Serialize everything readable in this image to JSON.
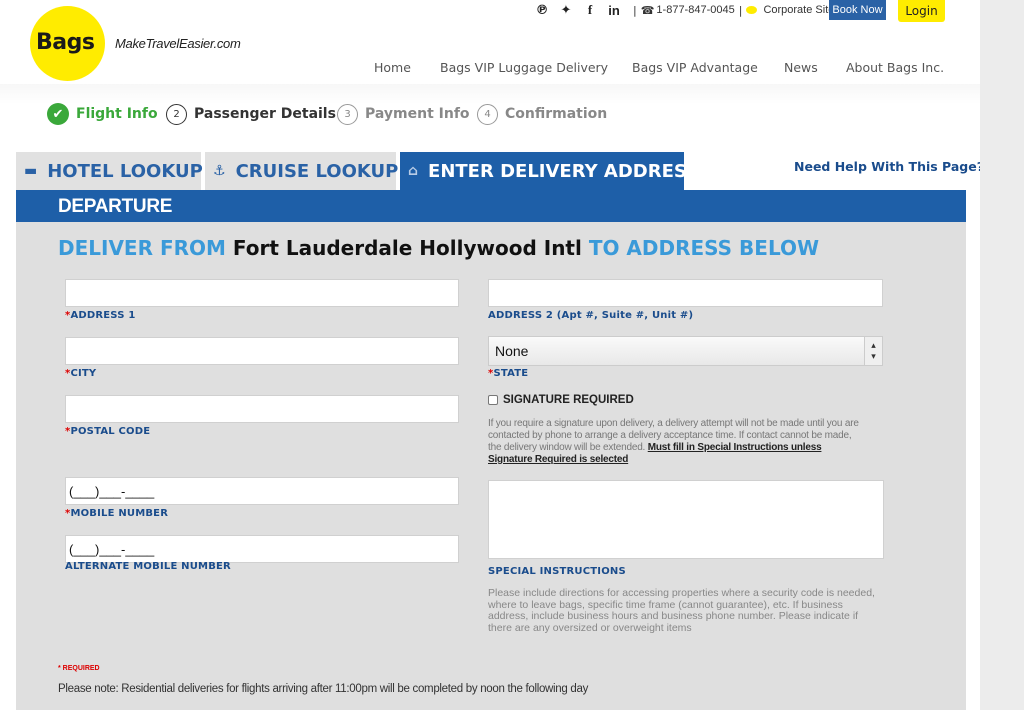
{
  "header": {
    "logo_text": "Bags",
    "tagline": "MakeTravelEasier.com",
    "phone": "1-877-847-0045",
    "corporate_site": "Corporate Site",
    "book_now": "Book Now",
    "login": "Login",
    "separator": "|"
  },
  "nav": {
    "items": [
      "Home",
      "Bags VIP Luggage Delivery",
      "Bags VIP Advantage",
      "News",
      "About Bags Inc."
    ]
  },
  "steps": [
    {
      "num": "✔",
      "label": "Flight Info",
      "state": "done"
    },
    {
      "num": "2",
      "label": "Passenger Details",
      "state": "current"
    },
    {
      "num": "3",
      "label": "Payment Info",
      "state": "future"
    },
    {
      "num": "4",
      "label": "Confirmation",
      "state": "future"
    }
  ],
  "tabs": [
    {
      "label": "HOTEL LOOKUP",
      "icon": "bed-icon"
    },
    {
      "label": "CRUISE LOOKUP",
      "icon": "ship-icon"
    },
    {
      "label": "ENTER DELIVERY ADDRESS",
      "icon": "home-icon",
      "active": true
    }
  ],
  "help_link": "Need Help With This Page?",
  "panel": {
    "title": "DEPARTURE",
    "deliver_prefix": "DELIVER FROM",
    "airport": "Fort Lauderdale Hollywood Intl",
    "deliver_suffix": "TO ADDRESS BELOW"
  },
  "form": {
    "required_mark": "*",
    "address1_label": "ADDRESS 1",
    "address2_label": "ADDRESS 2 (Apt #, Suite #, Unit #)",
    "city_label": "CITY",
    "state_label": "STATE",
    "state_value": "None",
    "postal_label": "POSTAL CODE",
    "signature_label": "SIGNATURE REQUIRED",
    "signature_note": "If you require a signature upon delivery, a delivery attempt will not be made until you are contacted by phone to arrange a delivery acceptance time. If contact cannot be made, the delivery window will be extended.",
    "signature_note_strong": "Must fill in Special Instructions unless Signature Required is selected",
    "mobile_label": "MOBILE NUMBER",
    "mobile_mask": "(___)___-____",
    "alt_mobile_label": "ALTERNATE MOBILE NUMBER",
    "alt_mobile_mask": "(___)___-____",
    "special_label": "SPECIAL INSTRUCTIONS",
    "special_note": "Please include directions for accessing properties where a security code is needed, where to leave bags, specific time frame (cannot guarantee), etc. If business address, include business hours and business phone number. Please indicate if there are any oversized or overweight items"
  },
  "footer": {
    "required_note": "* REQUIRED",
    "note": "Please note: Residential deliveries for flights arriving after 11:00pm will be completed by noon the following day"
  },
  "colors": {
    "brand_yellow": "#ffec00",
    "brand_blue": "#1e5fa8",
    "accent_blue": "#3a9ad9",
    "success_green": "#3aa83a",
    "required_red": "#dd0000"
  }
}
